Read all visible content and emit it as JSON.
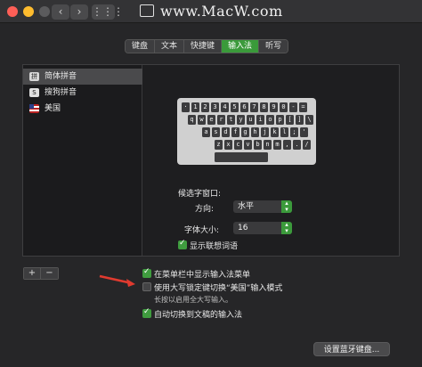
{
  "window": {
    "watermark": "www.MacW.com",
    "nav": {
      "back": "‹",
      "forward": "›",
      "grid": "⋮⋮⋮"
    }
  },
  "tabs": [
    "键盘",
    "文本",
    "快捷键",
    "输入法",
    "听写"
  ],
  "active_tab": "输入法",
  "input_sources": [
    {
      "label": "简体拼音",
      "icon": "jianpin-icon",
      "selected": true
    },
    {
      "label": "搜狗拼音",
      "icon": "sogou-icon",
      "selected": false
    },
    {
      "label": "美国",
      "icon": "us-flag-icon",
      "selected": false
    }
  ],
  "keyboard": {
    "rows": [
      [
        "·",
        "1",
        "2",
        "3",
        "4",
        "5",
        "6",
        "7",
        "8",
        "9",
        "0",
        "-",
        "="
      ],
      [
        "q",
        "w",
        "e",
        "r",
        "t",
        "y",
        "u",
        "i",
        "o",
        "p",
        "[",
        "]",
        "\\"
      ],
      [
        "a",
        "s",
        "d",
        "f",
        "g",
        "h",
        "j",
        "k",
        "l",
        ";",
        "'"
      ],
      [
        "z",
        "x",
        "c",
        "v",
        "b",
        "n",
        "m",
        ",",
        ".",
        "/"
      ]
    ]
  },
  "candidate_window": {
    "heading": "候选字窗口:",
    "orientation_label": "方向:",
    "orientation_value": "水平",
    "font_size_label": "字体大小:",
    "font_size_value": "16",
    "show_suggestions_label": "显示联想词语",
    "show_suggestions": true
  },
  "options": {
    "show_menu_label": "在菜单栏中显示输入法菜单",
    "show_menu": true,
    "caps_lock_label": "使用大写锁定键切换“美国”输入模式",
    "caps_lock": false,
    "caps_lock_hint": "长按以启用全大写输入。",
    "auto_switch_label": "自动切换到文稿的输入法",
    "auto_switch": true
  },
  "list_controls": {
    "add": "+",
    "remove": "−"
  },
  "bluetooth_button": "设置蓝牙键盘...",
  "colors": {
    "accent_green": "#3f9c3f",
    "arrow_red": "#e03a2f"
  }
}
